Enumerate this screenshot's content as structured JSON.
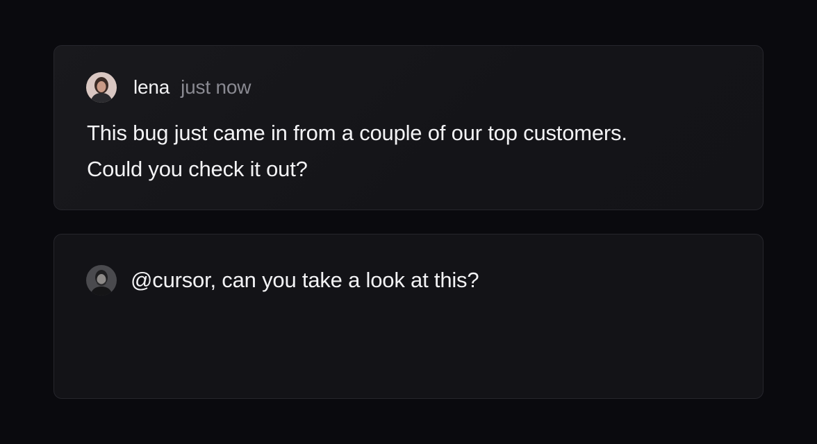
{
  "comment": {
    "author": "lena",
    "timestamp": "just now",
    "lines": [
      "This bug just came in from a couple of our top customers.",
      "Could you check it out?"
    ]
  },
  "reply": {
    "text": "@cursor, can you take a look at this?"
  },
  "colors": {
    "background": "#0a0a0e",
    "card": "#141418",
    "border": "#26262c",
    "text": "#f3f3f5",
    "muted": "#8a8a92"
  }
}
